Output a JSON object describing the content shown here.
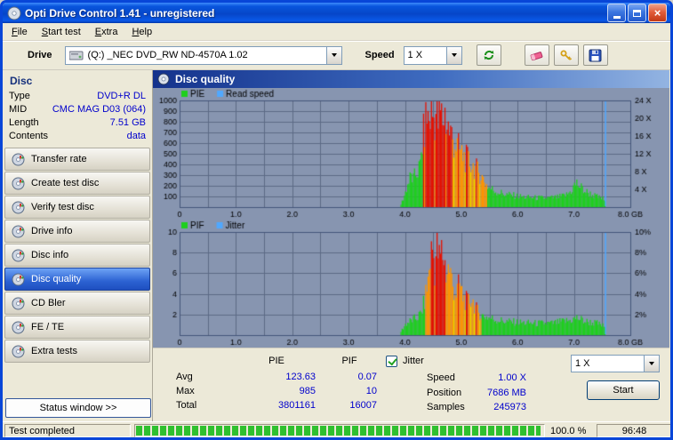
{
  "window": {
    "title": "Opti Drive Control 1.41 - unregistered"
  },
  "menu": {
    "items": [
      "File",
      "Start test",
      "Extra",
      "Help"
    ]
  },
  "drive_bar": {
    "drive_label": "Drive",
    "drive_value": "(Q:)   _NEC DVD_RW ND-4570A 1.02",
    "speed_label": "Speed",
    "speed_value": "1 X"
  },
  "sidebar": {
    "header": "Disc",
    "info": [
      {
        "label": "Type",
        "value": "DVD+R DL"
      },
      {
        "label": "MID",
        "value": "CMC MAG D03 (064)"
      },
      {
        "label": "Length",
        "value": "7.51 GB"
      },
      {
        "label": "Contents",
        "value": "data"
      }
    ],
    "buttons": [
      {
        "label": "Transfer rate"
      },
      {
        "label": "Create test disc"
      },
      {
        "label": "Verify test disc"
      },
      {
        "label": "Drive info"
      },
      {
        "label": "Disc info"
      },
      {
        "label": "Disc quality"
      },
      {
        "label": "CD Bler"
      },
      {
        "label": "FE / TE"
      },
      {
        "label": "Extra tests"
      }
    ],
    "status_window": "Status window >>"
  },
  "main": {
    "header": "Disc quality",
    "stats": {
      "col_pie": "PIE",
      "col_pif": "PIF",
      "rows": [
        {
          "label": "Avg",
          "pie": "123.63",
          "pif": "0.07"
        },
        {
          "label": "Max",
          "pie": "985",
          "pif": "10"
        },
        {
          "label": "Total",
          "pie": "3801161",
          "pif": "16007"
        }
      ],
      "jitter_label": "Jitter",
      "jitter_checked": true,
      "speed_label": "Speed",
      "speed_value": "1.00 X",
      "position_label": "Position",
      "position_value": "7686 MB",
      "samples_label": "Samples",
      "samples_value": "245973",
      "speed_select": "1 X",
      "start_button": "Start"
    }
  },
  "status_bar": {
    "text": "Test completed",
    "percent": "100.0 %",
    "time": "96:48"
  },
  "chart_data": [
    {
      "type": "bar",
      "title": "PIE / Read speed",
      "legend": [
        {
          "label": "PIE",
          "color_key": "g"
        },
        {
          "label": "Read speed",
          "color_key": "line"
        }
      ],
      "x_range": [
        0,
        8
      ],
      "x_ticks": [
        [
          0,
          "0"
        ],
        [
          1,
          "1.0"
        ],
        [
          2,
          "2.0"
        ],
        [
          3,
          "3.0"
        ],
        [
          4,
          "4.0"
        ],
        [
          5,
          "5.0"
        ],
        [
          6,
          "6.0"
        ],
        [
          7,
          "7.0"
        ],
        [
          8,
          "8.0 GB"
        ]
      ],
      "y_left": {
        "max": 1000,
        "ticks": [
          100,
          200,
          300,
          400,
          500,
          600,
          700,
          800,
          900,
          1000
        ]
      },
      "y_right": {
        "max": 24,
        "ticks": [
          [
            4,
            "4 X"
          ],
          [
            8,
            "8 X"
          ],
          [
            12,
            "12 X"
          ],
          [
            16,
            "16 X"
          ],
          [
            20,
            "20 X"
          ],
          [
            24,
            "24 X"
          ]
        ]
      },
      "end_line_x": 7.56,
      "palette": {
        "g": "#1ecf1e",
        "y": "#dede00",
        "o": "#ff9500",
        "r": "#e61000",
        "line": "#4fa8ff",
        "bg": "#8795b0",
        "grid": "#5c6a85",
        "border": "#44557a",
        "text": "#000000"
      },
      "series": [
        {
          "name": "PIE",
          "points": [
            [
              3.92,
              30,
              "g"
            ],
            [
              3.96,
              90,
              "g"
            ],
            [
              4.0,
              160,
              "g"
            ],
            [
              4.05,
              260,
              "g"
            ],
            [
              4.1,
              330,
              "g"
            ],
            [
              4.14,
              290,
              "g"
            ],
            [
              4.18,
              350,
              "g"
            ],
            [
              4.22,
              390,
              "g"
            ],
            [
              4.26,
              430,
              "g"
            ],
            [
              4.3,
              680,
              "r"
            ],
            [
              4.34,
              850,
              "r"
            ],
            [
              4.38,
              980,
              "r"
            ],
            [
              4.42,
              930,
              "r"
            ],
            [
              4.46,
              1000,
              "r"
            ],
            [
              4.5,
              960,
              "r"
            ],
            [
              4.54,
              1000,
              "r"
            ],
            [
              4.58,
              900,
              "r"
            ],
            [
              4.62,
              1000,
              "r"
            ],
            [
              4.66,
              940,
              "r"
            ],
            [
              4.7,
              1000,
              "r"
            ],
            [
              4.74,
              880,
              "r"
            ],
            [
              4.78,
              820,
              "r"
            ],
            [
              4.82,
              760,
              "o"
            ],
            [
              4.86,
              700,
              "o"
            ],
            [
              4.9,
              660,
              "o"
            ],
            [
              4.95,
              610,
              "o"
            ],
            [
              5.0,
              570,
              "o"
            ],
            [
              5.05,
              530,
              "o"
            ],
            [
              5.1,
              500,
              "o"
            ],
            [
              5.15,
              470,
              "o"
            ],
            [
              5.2,
              440,
              "o"
            ],
            [
              5.25,
              410,
              "o"
            ],
            [
              5.3,
              370,
              "o"
            ],
            [
              5.35,
              330,
              "o"
            ],
            [
              5.4,
              280,
              "o"
            ],
            [
              5.45,
              230,
              "g"
            ],
            [
              5.5,
              200,
              "g"
            ],
            [
              5.6,
              170,
              "g"
            ],
            [
              5.7,
              150,
              "g"
            ],
            [
              5.8,
              135,
              "g"
            ],
            [
              5.9,
              125,
              "g"
            ],
            [
              6.0,
              115,
              "g"
            ],
            [
              6.15,
              105,
              "g"
            ],
            [
              6.3,
              100,
              "g"
            ],
            [
              6.5,
              95,
              "g"
            ],
            [
              6.7,
              105,
              "g"
            ],
            [
              6.85,
              125,
              "g"
            ],
            [
              6.95,
              180,
              "g"
            ],
            [
              7.0,
              235,
              "g"
            ],
            [
              7.05,
              255,
              "g"
            ],
            [
              7.1,
              215,
              "g"
            ],
            [
              7.2,
              165,
              "g"
            ],
            [
              7.3,
              135,
              "g"
            ],
            [
              7.4,
              110,
              "g"
            ],
            [
              7.5,
              90,
              "g"
            ],
            [
              7.55,
              60,
              "g"
            ]
          ]
        }
      ]
    },
    {
      "type": "bar",
      "title": "PIF / Jitter",
      "legend": [
        {
          "label": "PIF",
          "color_key": "g"
        },
        {
          "label": "Jitter",
          "color_key": "line"
        }
      ],
      "x_range": [
        0,
        8
      ],
      "x_ticks": [
        [
          0,
          "0"
        ],
        [
          1,
          "1.0"
        ],
        [
          2,
          "2.0"
        ],
        [
          3,
          "3.0"
        ],
        [
          4,
          "4.0"
        ],
        [
          5,
          "5.0"
        ],
        [
          6,
          "6.0"
        ],
        [
          7,
          "7.0"
        ],
        [
          8,
          "8.0 GB"
        ]
      ],
      "y_left": {
        "max": 10,
        "ticks": [
          2,
          4,
          6,
          8,
          10
        ]
      },
      "y_right": {
        "max": 10,
        "ticks": [
          [
            2,
            "2%"
          ],
          [
            4,
            "4%"
          ],
          [
            6,
            "6%"
          ],
          [
            8,
            "8%"
          ],
          [
            10,
            "10%"
          ]
        ]
      },
      "end_line_x": 7.56,
      "palette": {
        "g": "#1ecf1e",
        "y": "#dede00",
        "o": "#ff9500",
        "r": "#e61000",
        "line": "#4fa8ff",
        "bg": "#8795b0",
        "grid": "#5c6a85",
        "border": "#44557a",
        "text": "#000000"
      },
      "series": [
        {
          "name": "PIF",
          "points": [
            [
              3.92,
              0.4,
              "g"
            ],
            [
              4.0,
              1.2,
              "g"
            ],
            [
              4.1,
              1.6,
              "g"
            ],
            [
              4.2,
              1.9,
              "g"
            ],
            [
              4.28,
              2.4,
              "g"
            ],
            [
              4.34,
              3.8,
              "o"
            ],
            [
              4.4,
              6.0,
              "o"
            ],
            [
              4.44,
              8.5,
              "r"
            ],
            [
              4.48,
              9.6,
              "r"
            ],
            [
              4.52,
              7.5,
              "r"
            ],
            [
              4.56,
              10.0,
              "r"
            ],
            [
              4.6,
              8.2,
              "r"
            ],
            [
              4.64,
              9.2,
              "r"
            ],
            [
              4.68,
              8.6,
              "r"
            ],
            [
              4.72,
              7.0,
              "o"
            ],
            [
              4.78,
              7.4,
              "o"
            ],
            [
              4.84,
              5.4,
              "o"
            ],
            [
              4.9,
              4.6,
              "o"
            ],
            [
              4.96,
              5.6,
              "o"
            ],
            [
              5.02,
              4.2,
              "o"
            ],
            [
              5.1,
              3.6,
              "o"
            ],
            [
              5.18,
              4.0,
              "o"
            ],
            [
              5.26,
              2.8,
              "o"
            ],
            [
              5.34,
              2.2,
              "g"
            ],
            [
              5.45,
              2.0,
              "g"
            ],
            [
              5.6,
              1.7,
              "g"
            ],
            [
              5.8,
              1.5,
              "g"
            ],
            [
              6.0,
              1.4,
              "g"
            ],
            [
              6.3,
              1.3,
              "g"
            ],
            [
              6.6,
              1.3,
              "g"
            ],
            [
              6.9,
              1.6,
              "g"
            ],
            [
              7.05,
              1.9,
              "g"
            ],
            [
              7.2,
              1.5,
              "g"
            ],
            [
              7.4,
              1.3,
              "g"
            ],
            [
              7.55,
              0.9,
              "g"
            ]
          ]
        }
      ]
    }
  ]
}
